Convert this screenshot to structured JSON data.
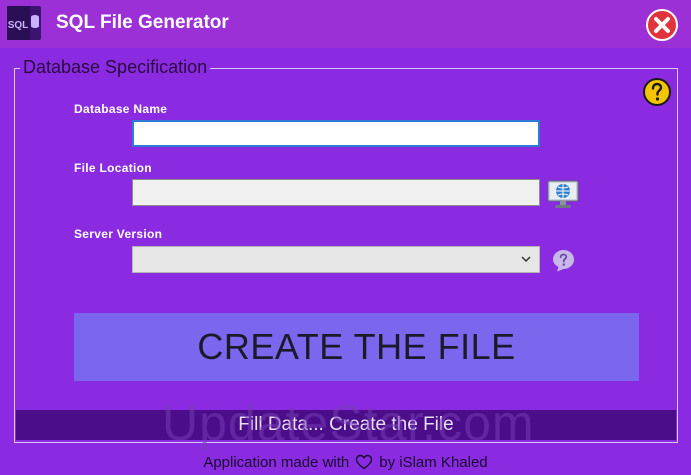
{
  "window": {
    "title": "SQL File Generator",
    "app_icon_text": "SQL",
    "close_icon": "close-icon"
  },
  "group": {
    "legend": "Database Specification",
    "help_icon": "question-icon"
  },
  "fields": {
    "database_name": {
      "label": "Database Name",
      "value": ""
    },
    "file_location": {
      "label": "File Location",
      "value": ""
    },
    "server_version": {
      "label": "Server Version",
      "selected": ""
    }
  },
  "buttons": {
    "create": "CREATE THE FILE",
    "browse_icon": "globe-monitor-icon",
    "version_help_icon": "question-bubble-icon"
  },
  "status": {
    "text": "Fill Data... Create the File"
  },
  "watermark": {
    "text": "UpdateStar.com"
  },
  "footer": {
    "before": "Application made with",
    "heart_icon": "heart-icon",
    "after": "by iSlam Khaled"
  },
  "colors": {
    "background": "#8a2be2",
    "titlebar": "#9b30d6",
    "create_button": "#7a67ee",
    "status_bar": "#4b0d8a",
    "close_red": "#e0333b",
    "help_yellow": "#f5c400"
  }
}
